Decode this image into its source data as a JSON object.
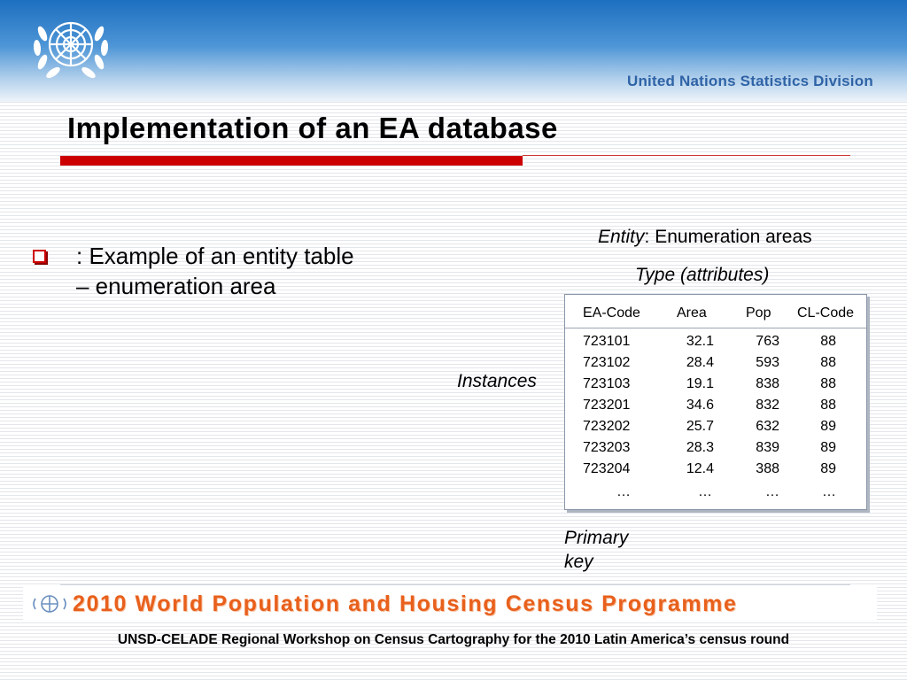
{
  "header": {
    "logo": "un-emblem-icon",
    "division": "United Nations Statistics Division"
  },
  "slide": {
    "title": "Implementation of an EA database",
    "bullet": {
      "icon": "square-bullet-icon",
      "line1": ": Example of an entity table",
      "line2": "– enumeration area"
    },
    "entity_caption": {
      "label": "Entity",
      "value": ": Enumeration areas"
    },
    "type_caption": "Type (attributes)",
    "instances_label": "Instances",
    "primary_key_label": "Primary key"
  },
  "table": {
    "columns": [
      "EA-Code",
      "Area",
      "Pop",
      "CL-Code"
    ],
    "rows": [
      [
        "723101",
        "32.1",
        "763",
        "88"
      ],
      [
        "723102",
        "28.4",
        "593",
        "88"
      ],
      [
        "723103",
        "19.1",
        "838",
        "88"
      ],
      [
        "723201",
        "34.6",
        "832",
        "88"
      ],
      [
        "723202",
        "25.7",
        "632",
        "89"
      ],
      [
        "723203",
        "28.3",
        "839",
        "89"
      ],
      [
        "723204",
        "12.4",
        "388",
        "89"
      ],
      [
        "…",
        "…",
        "…",
        "…"
      ]
    ]
  },
  "footer": {
    "banner": "2010 World Population and Housing Census Programme",
    "banner_logo": "census-emblem-icon",
    "workshop": "UNSD-CELADE Regional Workshop on Census Cartography for the 2010 Latin America’s census round"
  },
  "colors": {
    "accent_red": "#cc0000",
    "header_blue": "#1d6fc0",
    "division_text": "#2f63a6",
    "banner_orange": "#e8601c"
  }
}
